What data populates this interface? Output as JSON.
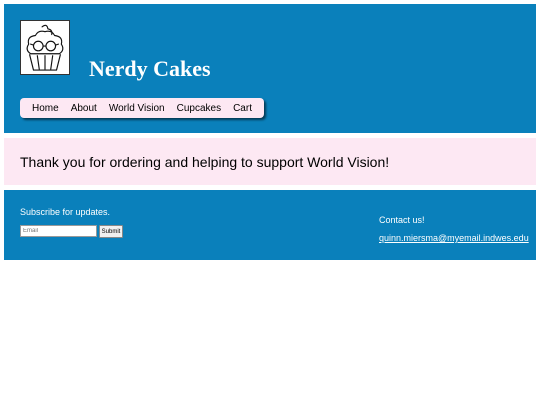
{
  "header": {
    "title": "Nerdy Cakes",
    "logo_icon": "cupcake-with-glasses-icon",
    "background_color": "#0a80bb"
  },
  "nav": {
    "items": [
      "Home",
      "About",
      "World Vision",
      "Cupcakes",
      "Cart"
    ],
    "background_color": "#fde8f3"
  },
  "message": {
    "text": "Thank you for ordering and helping to support World Vision!"
  },
  "footer": {
    "subscribe_label": "Subscribe for updates.",
    "email_placeholder": "Email",
    "submit_label": "Submit",
    "contact_label": "Contact us!",
    "contact_email": "quinn.miersma@myemail.indwes.edu"
  }
}
